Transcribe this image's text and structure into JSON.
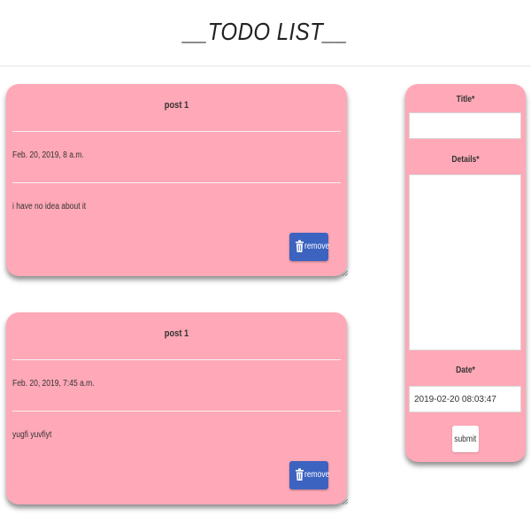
{
  "header": {
    "title": "__TODO LIST__"
  },
  "posts": [
    {
      "title": "post 1",
      "date": "Feb. 20, 2019, 8 a.m.",
      "details": "i have no idea about it",
      "remove_label": "remove"
    },
    {
      "title": "post 1",
      "date": "Feb. 20, 2019, 7:45 a.m.",
      "details": "yugfi yuvfiyt",
      "remove_label": "remove"
    }
  ],
  "form": {
    "title_label": "Title*",
    "title_value": "",
    "details_label": "Details*",
    "details_value": "",
    "date_label": "Date*",
    "date_value": "2019-02-20 08:03:47",
    "submit_label": "submit"
  },
  "colors": {
    "card_background": "#ffa8b7",
    "remove_button": "#3d63c0"
  },
  "icons": {
    "remove": "trash-icon"
  }
}
